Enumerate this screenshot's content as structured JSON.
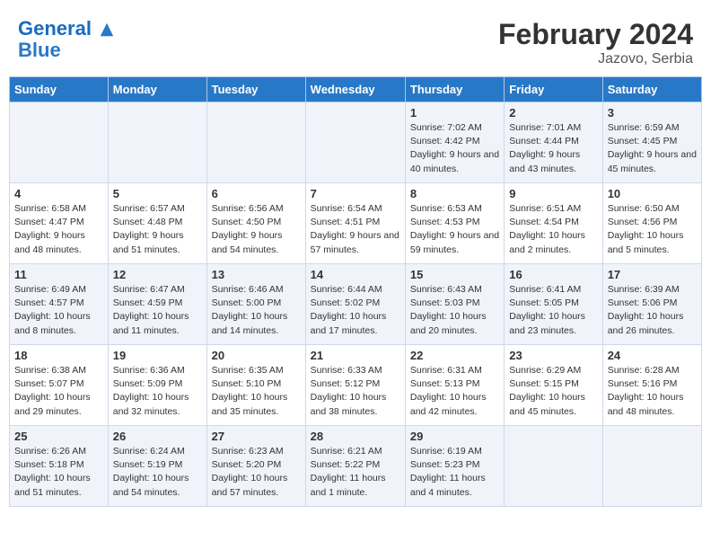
{
  "header": {
    "logo_line1": "General",
    "logo_line2": "Blue",
    "month_year": "February 2024",
    "location": "Jazovo, Serbia"
  },
  "days_of_week": [
    "Sunday",
    "Monday",
    "Tuesday",
    "Wednesday",
    "Thursday",
    "Friday",
    "Saturday"
  ],
  "weeks": [
    [
      {
        "day": "",
        "info": ""
      },
      {
        "day": "",
        "info": ""
      },
      {
        "day": "",
        "info": ""
      },
      {
        "day": "",
        "info": ""
      },
      {
        "day": "1",
        "sunrise": "Sunrise: 7:02 AM",
        "sunset": "Sunset: 4:42 PM",
        "daylight": "Daylight: 9 hours and 40 minutes."
      },
      {
        "day": "2",
        "sunrise": "Sunrise: 7:01 AM",
        "sunset": "Sunset: 4:44 PM",
        "daylight": "Daylight: 9 hours and 43 minutes."
      },
      {
        "day": "3",
        "sunrise": "Sunrise: 6:59 AM",
        "sunset": "Sunset: 4:45 PM",
        "daylight": "Daylight: 9 hours and 45 minutes."
      }
    ],
    [
      {
        "day": "4",
        "sunrise": "Sunrise: 6:58 AM",
        "sunset": "Sunset: 4:47 PM",
        "daylight": "Daylight: 9 hours and 48 minutes."
      },
      {
        "day": "5",
        "sunrise": "Sunrise: 6:57 AM",
        "sunset": "Sunset: 4:48 PM",
        "daylight": "Daylight: 9 hours and 51 minutes."
      },
      {
        "day": "6",
        "sunrise": "Sunrise: 6:56 AM",
        "sunset": "Sunset: 4:50 PM",
        "daylight": "Daylight: 9 hours and 54 minutes."
      },
      {
        "day": "7",
        "sunrise": "Sunrise: 6:54 AM",
        "sunset": "Sunset: 4:51 PM",
        "daylight": "Daylight: 9 hours and 57 minutes."
      },
      {
        "day": "8",
        "sunrise": "Sunrise: 6:53 AM",
        "sunset": "Sunset: 4:53 PM",
        "daylight": "Daylight: 9 hours and 59 minutes."
      },
      {
        "day": "9",
        "sunrise": "Sunrise: 6:51 AM",
        "sunset": "Sunset: 4:54 PM",
        "daylight": "Daylight: 10 hours and 2 minutes."
      },
      {
        "day": "10",
        "sunrise": "Sunrise: 6:50 AM",
        "sunset": "Sunset: 4:56 PM",
        "daylight": "Daylight: 10 hours and 5 minutes."
      }
    ],
    [
      {
        "day": "11",
        "sunrise": "Sunrise: 6:49 AM",
        "sunset": "Sunset: 4:57 PM",
        "daylight": "Daylight: 10 hours and 8 minutes."
      },
      {
        "day": "12",
        "sunrise": "Sunrise: 6:47 AM",
        "sunset": "Sunset: 4:59 PM",
        "daylight": "Daylight: 10 hours and 11 minutes."
      },
      {
        "day": "13",
        "sunrise": "Sunrise: 6:46 AM",
        "sunset": "Sunset: 5:00 PM",
        "daylight": "Daylight: 10 hours and 14 minutes."
      },
      {
        "day": "14",
        "sunrise": "Sunrise: 6:44 AM",
        "sunset": "Sunset: 5:02 PM",
        "daylight": "Daylight: 10 hours and 17 minutes."
      },
      {
        "day": "15",
        "sunrise": "Sunrise: 6:43 AM",
        "sunset": "Sunset: 5:03 PM",
        "daylight": "Daylight: 10 hours and 20 minutes."
      },
      {
        "day": "16",
        "sunrise": "Sunrise: 6:41 AM",
        "sunset": "Sunset: 5:05 PM",
        "daylight": "Daylight: 10 hours and 23 minutes."
      },
      {
        "day": "17",
        "sunrise": "Sunrise: 6:39 AM",
        "sunset": "Sunset: 5:06 PM",
        "daylight": "Daylight: 10 hours and 26 minutes."
      }
    ],
    [
      {
        "day": "18",
        "sunrise": "Sunrise: 6:38 AM",
        "sunset": "Sunset: 5:07 PM",
        "daylight": "Daylight: 10 hours and 29 minutes."
      },
      {
        "day": "19",
        "sunrise": "Sunrise: 6:36 AM",
        "sunset": "Sunset: 5:09 PM",
        "daylight": "Daylight: 10 hours and 32 minutes."
      },
      {
        "day": "20",
        "sunrise": "Sunrise: 6:35 AM",
        "sunset": "Sunset: 5:10 PM",
        "daylight": "Daylight: 10 hours and 35 minutes."
      },
      {
        "day": "21",
        "sunrise": "Sunrise: 6:33 AM",
        "sunset": "Sunset: 5:12 PM",
        "daylight": "Daylight: 10 hours and 38 minutes."
      },
      {
        "day": "22",
        "sunrise": "Sunrise: 6:31 AM",
        "sunset": "Sunset: 5:13 PM",
        "daylight": "Daylight: 10 hours and 42 minutes."
      },
      {
        "day": "23",
        "sunrise": "Sunrise: 6:29 AM",
        "sunset": "Sunset: 5:15 PM",
        "daylight": "Daylight: 10 hours and 45 minutes."
      },
      {
        "day": "24",
        "sunrise": "Sunrise: 6:28 AM",
        "sunset": "Sunset: 5:16 PM",
        "daylight": "Daylight: 10 hours and 48 minutes."
      }
    ],
    [
      {
        "day": "25",
        "sunrise": "Sunrise: 6:26 AM",
        "sunset": "Sunset: 5:18 PM",
        "daylight": "Daylight: 10 hours and 51 minutes."
      },
      {
        "day": "26",
        "sunrise": "Sunrise: 6:24 AM",
        "sunset": "Sunset: 5:19 PM",
        "daylight": "Daylight: 10 hours and 54 minutes."
      },
      {
        "day": "27",
        "sunrise": "Sunrise: 6:23 AM",
        "sunset": "Sunset: 5:20 PM",
        "daylight": "Daylight: 10 hours and 57 minutes."
      },
      {
        "day": "28",
        "sunrise": "Sunrise: 6:21 AM",
        "sunset": "Sunset: 5:22 PM",
        "daylight": "Daylight: 11 hours and 1 minute."
      },
      {
        "day": "29",
        "sunrise": "Sunrise: 6:19 AM",
        "sunset": "Sunset: 5:23 PM",
        "daylight": "Daylight: 11 hours and 4 minutes."
      },
      {
        "day": "",
        "info": ""
      },
      {
        "day": "",
        "info": ""
      }
    ]
  ]
}
